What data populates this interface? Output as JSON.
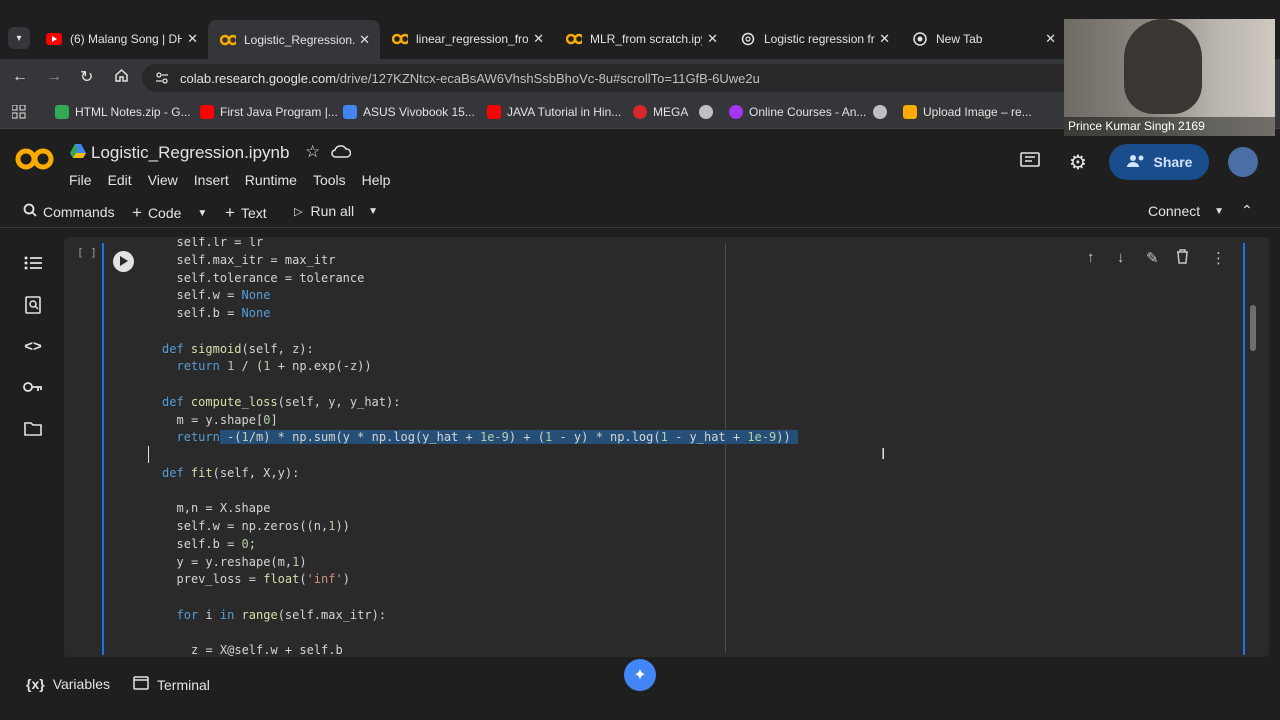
{
  "browser": {
    "tabs": [
      {
        "title": "(6) Malang Song | DH",
        "icon": "youtube-icon"
      },
      {
        "title": "Logistic_Regression.ip",
        "icon": "colab-icon",
        "active": true
      },
      {
        "title": "linear_regression_fror",
        "icon": "colab-icon"
      },
      {
        "title": "MLR_from scratch.ipy",
        "icon": "colab-icon"
      },
      {
        "title": "Logistic regression fr",
        "icon": "chatgpt-icon"
      },
      {
        "title": "New Tab",
        "icon": "chrome-icon"
      }
    ],
    "url_host": "colab.research.google.com",
    "url_path": "/drive/127KZNtcx-ecaBsAW6VhshSsbBhoVc-8u#scrollTo=11GfB-6Uwe2u",
    "bookmarks": [
      {
        "label": "HTML Notes.zip - G...",
        "color": "#34a853"
      },
      {
        "label": "First Java Program |...",
        "color": "#ff0000"
      },
      {
        "label": "ASUS Vivobook 15...",
        "color": "#4285f4"
      },
      {
        "label": "JAVA Tutorial in Hin...",
        "color": "#ff0000"
      },
      {
        "label": "MEGA",
        "color": "#d9272e"
      },
      {
        "label": "",
        "color": "#bdc1c6"
      },
      {
        "label": "Online Courses - An...",
        "color": "#a435f0"
      },
      {
        "label": "",
        "color": "#bdc1c6"
      },
      {
        "label": "Upload Image – re...",
        "color": "#f9ab00"
      }
    ]
  },
  "webcam": {
    "label": "Prince Kumar Singh 2169"
  },
  "colab": {
    "notebook_title": "Logistic_Regression.ipynb",
    "menu": [
      "File",
      "Edit",
      "View",
      "Insert",
      "Runtime",
      "Tools",
      "Help"
    ],
    "share_label": "Share",
    "commands_label": "Commands",
    "code_label": "Code",
    "text_label": "Text",
    "run_all_label": "Run all",
    "connect_label": "Connect",
    "cell_bracket": "[ ]",
    "variables_label": "Variables",
    "terminal_label": "Terminal"
  },
  "code_lines": [
    {
      "indent": 1,
      "html": "self.lr = lr"
    },
    {
      "indent": 1,
      "html": "self.max_itr = max_itr"
    },
    {
      "indent": 1,
      "html": "self.tolerance = tolerance"
    },
    {
      "indent": 1,
      "html": "self.w = <span class='cst'>None</span>"
    },
    {
      "indent": 1,
      "html": "self.b = <span class='cst'>None</span>"
    },
    {
      "indent": 0,
      "html": ""
    },
    {
      "indent": 0,
      "html": "<span class='kw'>def</span> <span class='fn'>sigmoid</span>(self, z):"
    },
    {
      "indent": 1,
      "html": "<span class='kw'>return</span> <span class='num'>1</span> / (<span class='num'>1</span> + np.exp(-z))"
    },
    {
      "indent": 0,
      "html": ""
    },
    {
      "indent": 0,
      "html": "<span class='kw'>def</span> <span class='fn'>compute_loss</span>(self, y, y_hat):"
    },
    {
      "indent": 1,
      "html": "m = y.shape[<span class='num'>0</span>]"
    },
    {
      "indent": 1,
      "html": "<span class='kw'>return</span><span class='sel'> -(<span class='num'>1</span>/m) * np.sum(y * np.log(y_hat + <span class='num'>1e-9</span>) + (<span class='num'>1</span> - y) * np.log(<span class='num'>1</span> - y_hat + <span class='num'>1e-9</span>)) </span>"
    },
    {
      "indent": 0,
      "html": ""
    },
    {
      "indent": 0,
      "html": "<span class='kw'>def</span> <span class='fn'>fit</span>(self, X,y):"
    },
    {
      "indent": 0,
      "html": ""
    },
    {
      "indent": 1,
      "html": "m,n = X.shape"
    },
    {
      "indent": 1,
      "html": "self.w = np.zeros((n,<span class='num'>1</span>))"
    },
    {
      "indent": 1,
      "html": "self.b = <span class='num'>0</span>;"
    },
    {
      "indent": 1,
      "html": "y = y.reshape(m,<span class='num'>1</span>)"
    },
    {
      "indent": 1,
      "html": "prev_loss = <span class='fn'>float</span>(<span class='str'>'inf'</span>)"
    },
    {
      "indent": 0,
      "html": ""
    },
    {
      "indent": 1,
      "html": "<span class='kw'>for</span> i <span class='kw'>in</span> <span class='fn'>range</span>(self.max_itr):"
    },
    {
      "indent": 0,
      "html": ""
    },
    {
      "indent": 2,
      "html": "z = X@self.w + self.b"
    }
  ]
}
